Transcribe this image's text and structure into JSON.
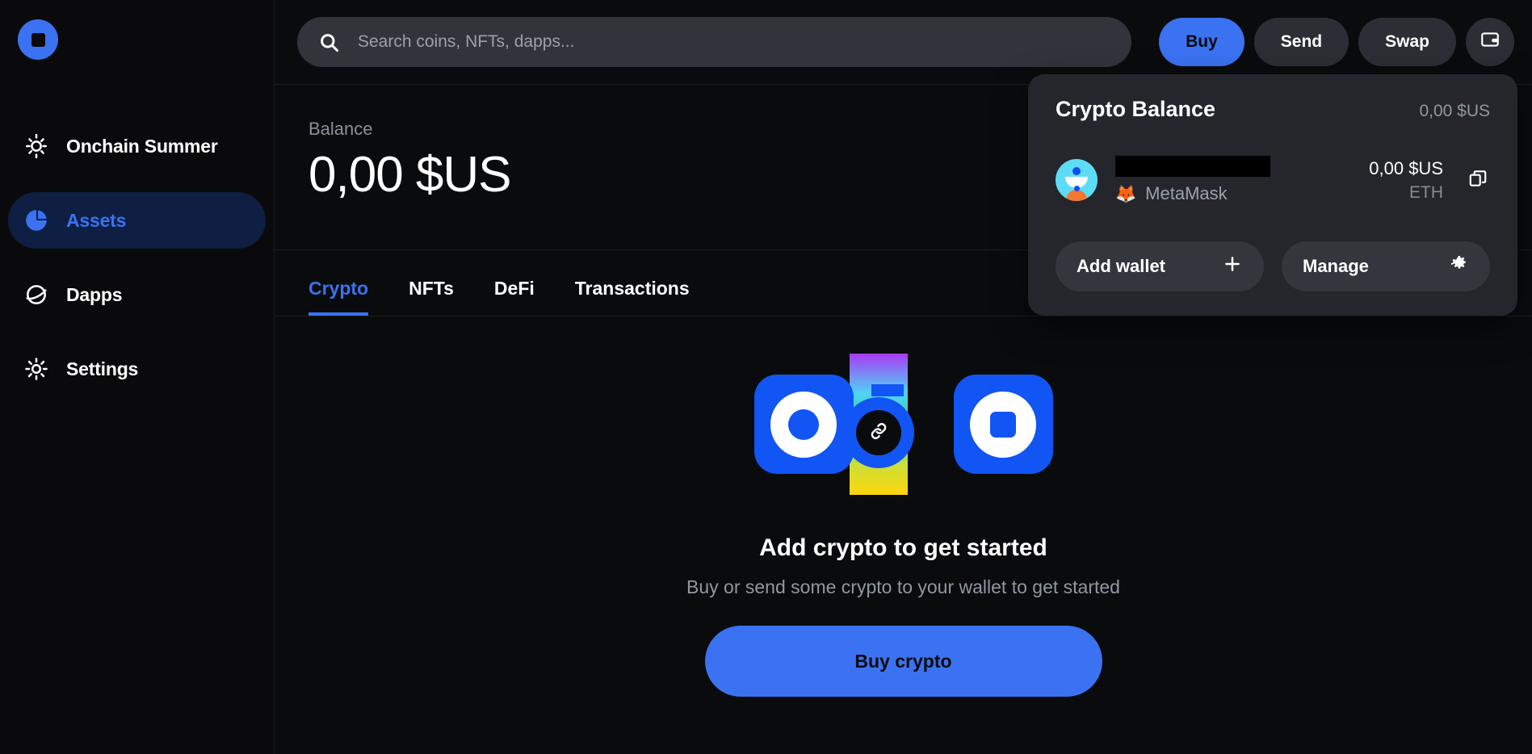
{
  "app": {
    "logo_icon": "coinbase-wallet-logo"
  },
  "sidebar": {
    "items": [
      {
        "label": "Onchain Summer",
        "icon": "sun-icon",
        "active": false
      },
      {
        "label": "Assets",
        "icon": "pie-chart-icon",
        "active": true
      },
      {
        "label": "Dapps",
        "icon": "planet-icon",
        "active": false
      },
      {
        "label": "Settings",
        "icon": "gear-icon",
        "active": false
      }
    ]
  },
  "search": {
    "placeholder": "Search coins, NFTs, dapps...",
    "value": "",
    "icon": "search-icon"
  },
  "toolbar": {
    "buy_label": "Buy",
    "send_label": "Send",
    "swap_label": "Swap",
    "wallet_icon": "wallet-icon",
    "primary_color": "#3b72f2"
  },
  "balance": {
    "label": "Balance",
    "value": "0,00 $US"
  },
  "tabs": [
    {
      "label": "Crypto",
      "active": true
    },
    {
      "label": "NFTs",
      "active": false
    },
    {
      "label": "DeFi",
      "active": false
    },
    {
      "label": "Transactions",
      "active": false
    }
  ],
  "empty_state": {
    "title": "Add crypto to get started",
    "subtitle": "Buy or send some crypto to your wallet to get started",
    "cta_label": "Buy crypto",
    "art": {
      "left_icon": "coinbase-logo",
      "center_icon": "link-icon",
      "right_icon": "coinbase-wallet-logo",
      "gradient_colors": [
        "#a93bf5",
        "#4fd3f7",
        "#2fd27a",
        "#c9e03a",
        "#ffd60a"
      ]
    }
  },
  "wallet_panel": {
    "title": "Crypto Balance",
    "total": "0,00 $US",
    "wallet": {
      "avatar_icon": "user-avatar",
      "address_redacted": "",
      "provider_icon": "metamask-fox-icon",
      "provider_name": "MetaMask",
      "amount": "0,00 $US",
      "symbol": "ETH",
      "copy_icon": "copy-icon"
    },
    "add_wallet_label": "Add wallet",
    "add_wallet_icon": "plus-icon",
    "manage_label": "Manage",
    "manage_icon": "gear-icon"
  }
}
